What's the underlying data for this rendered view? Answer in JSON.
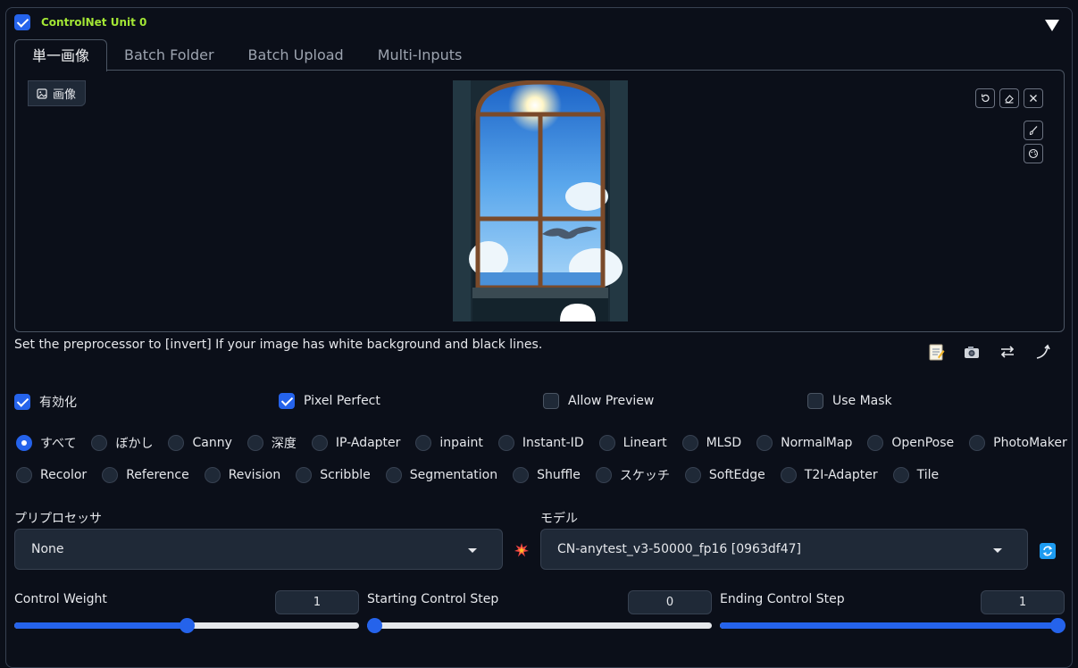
{
  "unit": {
    "title": "ControlNet Unit 0",
    "checked": true
  },
  "tabs": [
    {
      "label": "単一画像",
      "active": true
    },
    {
      "label": "Batch Folder"
    },
    {
      "label": "Batch Upload"
    },
    {
      "label": "Multi-Inputs"
    }
  ],
  "image": {
    "label": "画像"
  },
  "hint": "Set the preprocessor to [invert] If your image has white background and black lines.",
  "options": {
    "enable": {
      "label": "有効化",
      "checked": true
    },
    "pixel_perfect": {
      "label": "Pixel Perfect",
      "checked": true
    },
    "allow_preview": {
      "label": "Allow Preview",
      "checked": false
    },
    "use_mask": {
      "label": "Use Mask",
      "checked": false
    }
  },
  "control_types": {
    "selected": "すべて",
    "row1": [
      "すべて",
      "ぼかし",
      "Canny",
      "深度",
      "IP-Adapter",
      "inpaint",
      "Instant-ID",
      "Lineart",
      "MLSD",
      "NormalMap",
      "OpenPose",
      "PhotoMaker"
    ],
    "row2": [
      "Recolor",
      "Reference",
      "Revision",
      "Scribble",
      "Segmentation",
      "Shuffle",
      "スケッチ",
      "SoftEdge",
      "T2I-Adapter",
      "Tile"
    ]
  },
  "preprocessor": {
    "label": "プリプロセッサ",
    "value": "None"
  },
  "model": {
    "label": "モデル",
    "value": "CN-anytest_v3-50000_fp16 [0963df47]"
  },
  "sliders": {
    "weight": {
      "label": "Control Weight",
      "value": "1",
      "fraction": 0.5
    },
    "start": {
      "label": "Starting Control Step",
      "value": "0",
      "fraction": 0.0
    },
    "end": {
      "label": "Ending Control Step",
      "value": "1",
      "fraction": 1.0
    }
  },
  "colors": {
    "accent": "#2563eb",
    "title": "#a3e635",
    "background": "#0b0f19"
  }
}
